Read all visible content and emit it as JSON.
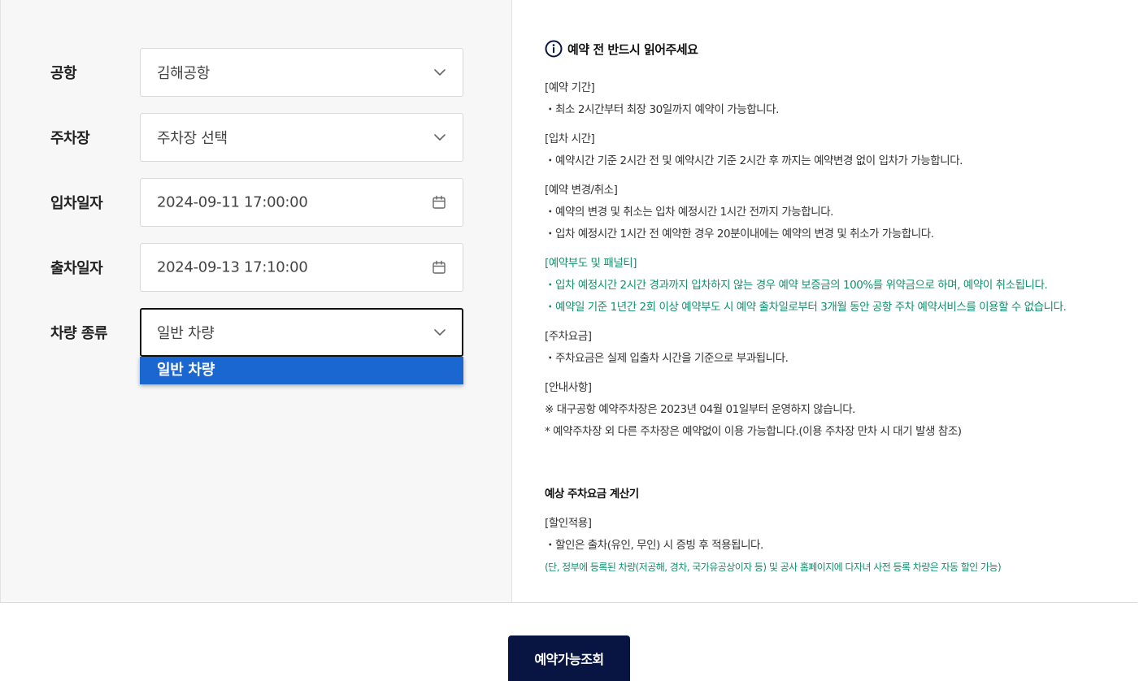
{
  "form": {
    "airport": {
      "label": "공항",
      "value": "김해공항"
    },
    "parking": {
      "label": "주차장",
      "value": "주차장 선택"
    },
    "entry_date": {
      "label": "입차일자",
      "value": "2024-09-11 17:00:00"
    },
    "exit_date": {
      "label": "출차일자",
      "value": "2024-09-13 17:10:00"
    },
    "vehicle_type": {
      "label": "차량 종류",
      "value": "일반 차량",
      "options": [
        "일반 차량"
      ]
    }
  },
  "notice": {
    "title": "예약 전 반드시 읽어주세요",
    "lines": [
      {
        "text": "[예약 기간]",
        "style": "normal"
      },
      {
        "text": "・최소 2시간부터 최장 30일까지 예약이 가능합니다.",
        "style": "normal"
      },
      {
        "text": "[입차 시간]",
        "style": "normal"
      },
      {
        "text": "・예약시간 기준 2시간 전 및 예약시간 기준 2시간 후 까지는 예약변경 없이 입차가 가능합니다.",
        "style": "normal"
      },
      {
        "text": "[예약 변경/취소]",
        "style": "normal"
      },
      {
        "text": "・예약의 변경 및 취소는 입차 예정시간 1시간 전까지 가능합니다.",
        "style": "normal"
      },
      {
        "text": "・입차 예정시간 1시간 전 예약한 경우 20분이내에는 예약의 변경 및 취소가 가능합니다.",
        "style": "normal"
      },
      {
        "text": "[예약부도 및 패널티]",
        "style": "green"
      },
      {
        "text": "・입차 예정시간 2시간 경과까지 입차하지 않는 경우 예약 보증금의 100%를 위약금으로 하며, 예약이 취소됩니다.",
        "style": "green"
      },
      {
        "text": "・예약일 기준 1년간 2회 이상 예약부도 시 예약 출차일로부터 3개월 동안 공항 주차 예약서비스를 이용할 수 없습니다.",
        "style": "green"
      },
      {
        "text": "[주차요금]",
        "style": "normal"
      },
      {
        "text": "・주차요금은 실제 입출차 시간을 기준으로 부과됩니다.",
        "style": "normal"
      },
      {
        "text": "[안내사항]",
        "style": "normal"
      },
      {
        "text": "※ 대구공항 예약주차장은 2023년 04월 01일부터 운영하지 않습니다.",
        "style": "normal"
      },
      {
        "text": "* 예약주차장 외 다른 주차장은 예약없이 이용 가능합니다.(이용 주차장 만차 시 대기 발생 참조)",
        "style": "normal"
      }
    ]
  },
  "calculator": {
    "title": "예상 주차요금 계산기",
    "lines": [
      {
        "text": "[할인적용]",
        "style": "normal"
      },
      {
        "text": "・할인은 출차(유인, 무인) 시 증빙 후 적용됩니다.",
        "style": "normal"
      },
      {
        "text": "(단, 정부에 등록된 차량(저공해, 경차, 국가유공상이자 등) 및 공사 홈페이지에 다자녀 사전 등록 차량은 자동 할인 가능)",
        "style": "green-small"
      }
    ]
  },
  "search_button": {
    "label": "예약가능조회"
  },
  "icons": {
    "select": "chevron-down-icon",
    "date": "calendar-icon",
    "notice": "info-icon"
  },
  "colors": {
    "navy": "#081442",
    "green": "#12906a",
    "selected_option": "#1a67d2",
    "panel_bg": "#f7f7f7"
  }
}
